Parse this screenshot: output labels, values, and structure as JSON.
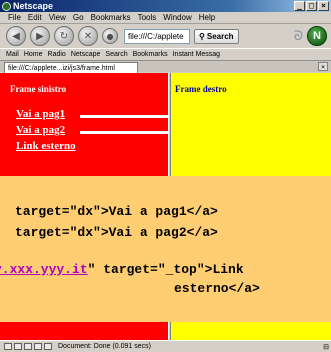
{
  "window": {
    "title": "Netscape",
    "minimize": "_",
    "maximize": "□",
    "close": "×"
  },
  "menu": [
    "File",
    "Edit",
    "View",
    "Go",
    "Bookmarks",
    "Tools",
    "Window",
    "Help"
  ],
  "nav": {
    "url": "file:///C:/applete",
    "search_label": "Search",
    "logo": "N"
  },
  "personal_bar": [
    "Mail",
    "Home",
    "Radio",
    "Netscape",
    "Search",
    "Bookmarks",
    "Instant Messag"
  ],
  "tab": {
    "label": "file:///C:/applete...izi/js3/frame.html",
    "close": "×"
  },
  "frames": {
    "left": {
      "title": "Frame sinistro",
      "links": [
        "Vai a pag1",
        "Vai a pag2",
        "Link esterno"
      ],
      "color": "#ff0000"
    },
    "right": {
      "title": "Frame destro",
      "color": "#ffff00"
    }
  },
  "code": {
    "line1": "target=\"dx\">Vai a pag1</a>",
    "line2": "target=\"dx\">Vai a pag2</a>",
    "line3_url": "y.xxx.yyy.it",
    "line3_rest": "\" target=\"_top\">Link",
    "line4": "esterno</a>",
    "background": "#ffce73"
  },
  "status": {
    "text": "Document: Done (0.091 secs)"
  }
}
